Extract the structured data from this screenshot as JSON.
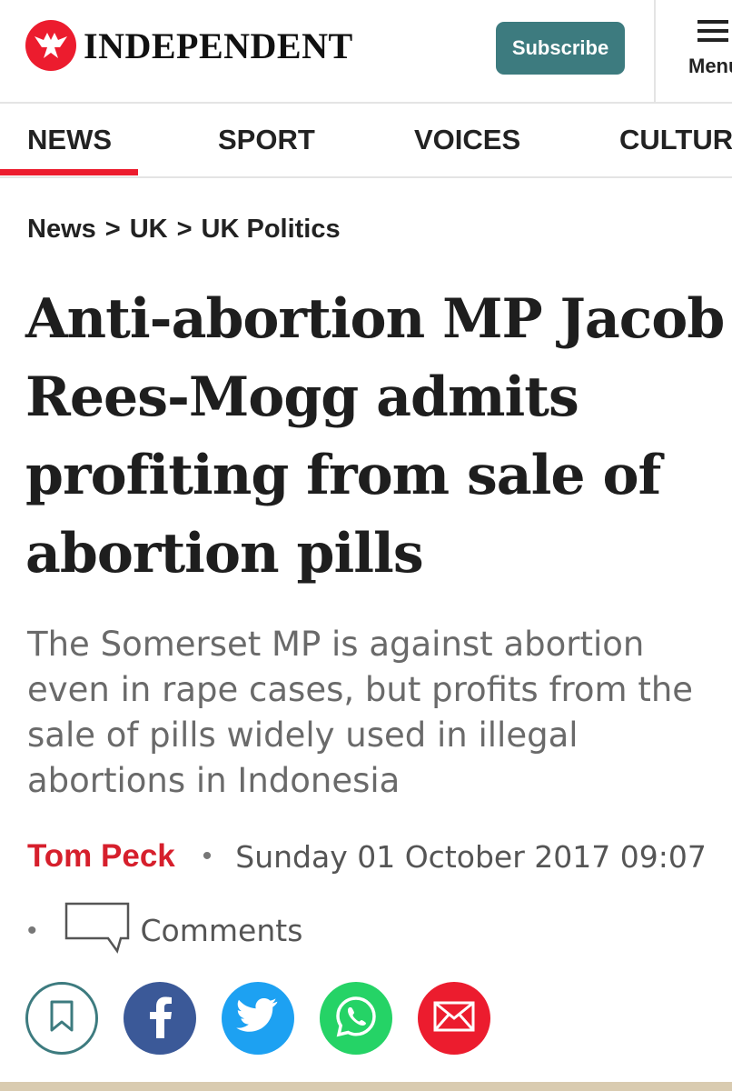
{
  "header": {
    "logo_text": "INDEPENDENT",
    "subscribe_label": "Subscribe",
    "menu_label": "Menu",
    "brand_color": "#ec1c2e",
    "subscribe_color": "#3d7b7f"
  },
  "nav": {
    "items": [
      {
        "label": "NEWS"
      },
      {
        "label": "SPORT"
      },
      {
        "label": "VOICES"
      },
      {
        "label": "CULTURE"
      }
    ]
  },
  "breadcrumb": {
    "items": [
      "News",
      "UK",
      "UK Politics"
    ],
    "separator": ">"
  },
  "article": {
    "headline": "Anti-abortion MP Jacob Rees-Mogg admits profiting from sale of abortion pills",
    "standfirst": "The Somerset MP is against abortion even in rape cases, but profits from the sale of pills widely used in illegal abortions in Indonesia",
    "author": "Tom Peck",
    "date": "Sunday 01 October 2017 09:07",
    "bullet": "•",
    "comments_label": "Comments"
  },
  "share": {
    "buttons": [
      {
        "icon": "bookmark-icon",
        "color": "#3d7b7f"
      },
      {
        "icon": "facebook-icon",
        "color": "#3b5998"
      },
      {
        "icon": "twitter-icon",
        "color": "#1da1f2"
      },
      {
        "icon": "whatsapp-icon",
        "color": "#25d366"
      },
      {
        "icon": "email-icon",
        "color": "#ec1c2e"
      }
    ]
  }
}
